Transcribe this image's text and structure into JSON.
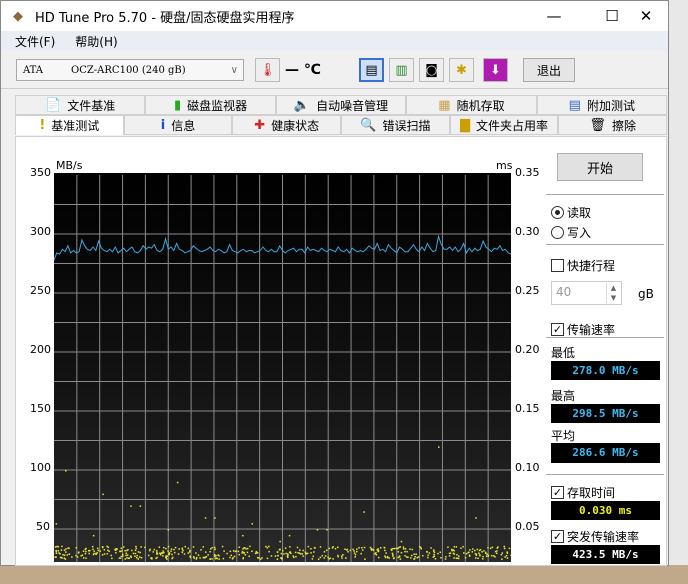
{
  "window": {
    "title": "HD Tune Pro 5.70 - 硬盘/固态硬盘实用程序"
  },
  "menu": [
    {
      "label": "文件(F)"
    },
    {
      "label": "帮助(H)"
    }
  ],
  "toolbar": {
    "drive_type": "ATA",
    "drive_name": "OCZ-ARC100 (240 gB)",
    "temperature": "— ℃",
    "exit_label": "退出"
  },
  "tabs_top": [
    {
      "label": "文件基准",
      "icon": "file-benchmark-icon"
    },
    {
      "label": "磁盘监视器",
      "icon": "disk-monitor-icon"
    },
    {
      "label": "自动噪音管理",
      "icon": "speaker-icon"
    },
    {
      "label": "随机存取",
      "icon": "random-access-icon"
    },
    {
      "label": "附加测试",
      "icon": "extra-tests-icon"
    }
  ],
  "tabs_bottom": [
    {
      "label": "基准测试",
      "icon": "exclamation-icon",
      "active": true
    },
    {
      "label": "信息",
      "icon": "info-icon"
    },
    {
      "label": "健康状态",
      "icon": "health-cross-icon"
    },
    {
      "label": "错误扫描",
      "icon": "magnifier-icon"
    },
    {
      "label": "文件夹占用率",
      "icon": "folder-icon"
    },
    {
      "label": "擦除",
      "icon": "trash-icon"
    }
  ],
  "side": {
    "start": "开始",
    "read": "读取",
    "write": "写入",
    "quick": "快捷行程",
    "quick_value": "40",
    "quick_unit": "gB",
    "transfer": "传输速率",
    "min_label": "最低",
    "min": "278.0 MB/s",
    "max_label": "最高",
    "max": "298.5 MB/s",
    "avg_label": "平均",
    "avg": "286.6 MB/s",
    "access_label": "存取时间",
    "access": "0.030 ms",
    "burst_label": "突发传输速率",
    "burst": "423.5 MB/s"
  },
  "chart_data": {
    "type": "line",
    "ylabel": "MB/s",
    "y2label": "ms",
    "ylim": [
      0,
      350
    ],
    "y2lim": [
      0,
      0.35
    ],
    "yticks": [
      "350",
      "300",
      "250",
      "200",
      "150",
      "100",
      "50"
    ],
    "y2ticks": [
      "0.35",
      "0.30",
      "0.25",
      "0.20",
      "0.15",
      "0.10",
      "0.05"
    ],
    "grid": true,
    "colors": {
      "transfer": "#3aa8e0",
      "access": "#e8e830"
    },
    "transfer_rate": [
      278,
      284,
      283,
      287,
      285,
      290,
      284,
      286,
      284,
      285,
      295,
      290,
      287,
      286,
      289,
      286,
      294,
      288,
      286,
      285,
      287,
      285,
      289,
      284,
      286,
      288,
      285,
      287,
      289,
      285,
      284,
      286,
      290,
      287,
      289,
      288,
      291,
      286,
      285,
      287,
      296,
      287,
      289,
      286,
      292,
      287,
      286,
      284,
      285,
      286,
      290,
      288,
      286,
      285,
      286,
      287,
      289,
      286,
      285,
      287,
      286,
      284,
      285,
      291,
      286,
      285,
      284,
      286,
      287,
      285,
      286,
      286,
      284,
      285,
      286,
      289,
      286,
      285,
      287,
      285,
      285,
      290,
      286,
      284,
      286,
      287,
      288,
      285,
      287,
      287,
      284,
      289,
      286,
      287,
      286,
      285,
      288,
      286,
      285,
      287,
      286,
      285,
      289,
      286,
      285,
      287,
      284,
      288,
      286,
      285,
      286,
      285,
      287,
      290,
      288,
      287,
      292,
      286,
      287,
      285,
      291,
      288,
      286,
      284,
      289,
      287,
      285,
      285,
      288,
      291,
      287,
      285,
      289,
      286,
      292,
      288,
      285,
      286,
      298,
      291,
      287,
      287,
      289,
      286,
      289,
      285,
      287,
      292,
      284,
      288,
      285,
      288,
      286,
      287,
      294,
      289,
      287,
      285,
      288,
      287,
      290,
      286,
      287,
      284,
      283
    ],
    "access_time_ms": [
      0.1,
      0.08,
      0.07,
      0.09,
      0.06,
      0.055,
      0.045,
      0.05,
      0.065,
      0.04,
      0.12,
      0.06,
      0.055,
      0.045,
      0.07,
      0.05,
      0.06,
      0.045,
      0.04,
      0.05
    ]
  }
}
